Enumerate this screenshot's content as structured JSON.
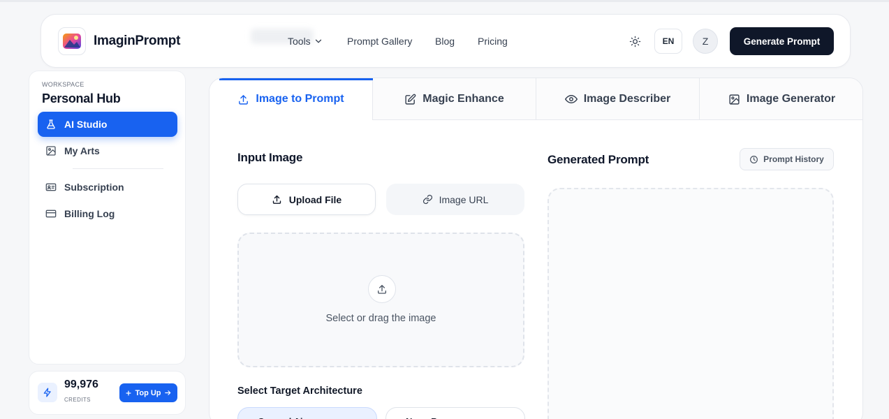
{
  "header": {
    "brand": "ImaginPrompt",
    "nav": [
      {
        "label": "Tools"
      },
      {
        "label": "Prompt Gallery"
      },
      {
        "label": "Blog"
      },
      {
        "label": "Pricing"
      }
    ],
    "lang": "EN",
    "avatar_initial": "Z",
    "cta": "Generate Prompt"
  },
  "sidebar": {
    "workspace_label": "WORKSPACE",
    "workspace_title": "Personal Hub",
    "items": [
      {
        "label": "AI Studio",
        "icon": "flask-icon",
        "active": true
      },
      {
        "label": "My Arts",
        "icon": "image-icon",
        "active": false
      },
      {
        "label": "Subscription",
        "icon": "id-card-icon",
        "active": false
      },
      {
        "label": "Billing Log",
        "icon": "credit-card-icon",
        "active": false
      }
    ],
    "credits": {
      "value": "99,976",
      "label": "CREDITS",
      "topup": "Top Up"
    }
  },
  "tabs": [
    {
      "label": "Image to Prompt",
      "icon": "upload-icon",
      "active": true
    },
    {
      "label": "Magic Enhance",
      "icon": "edit-icon",
      "active": false
    },
    {
      "label": "Image Describer",
      "icon": "eye-icon",
      "active": false
    },
    {
      "label": "Image Generator",
      "icon": "image-icon",
      "active": false
    }
  ],
  "input": {
    "title": "Input Image",
    "upload_label": "Upload File",
    "url_label": "Image URL",
    "dropzone_text": "Select or drag the image",
    "arch_title": "Select Target Architecture",
    "arch_options": [
      {
        "label": "General Ai",
        "selected": true
      },
      {
        "label": "Nano Banana",
        "selected": false
      }
    ]
  },
  "output": {
    "title": "Generated Prompt",
    "history_label": "Prompt History"
  },
  "colors": {
    "accent": "#1862f0",
    "dark_button": "#0f1729"
  }
}
